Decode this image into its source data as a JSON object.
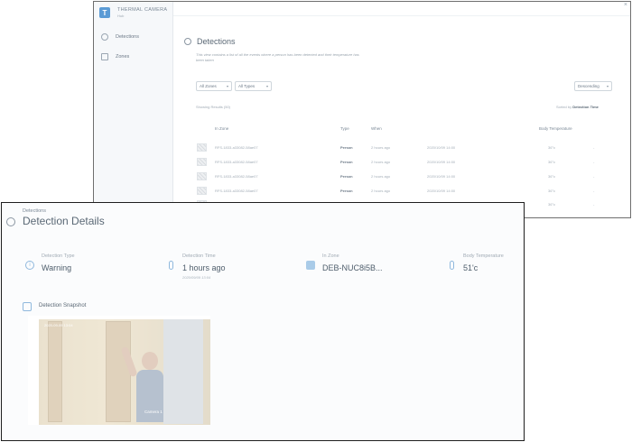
{
  "back": {
    "app": {
      "logo_letter": "T",
      "title": "THERMAL CAMERA",
      "subtitle": "Hub"
    },
    "nav": [
      {
        "label": "Detections",
        "icon": "detections-icon"
      },
      {
        "label": "Zones",
        "icon": "zones-icon"
      }
    ],
    "close_label": "×",
    "heading": "Detections",
    "description": "This view contains a list of all the events where a person has been detected and their temperature has been taken",
    "filters": {
      "zones": "All Zones",
      "types": "All Types",
      "order": "Descending"
    },
    "showing": "Showing Results (50)",
    "sorted_prefix": "Sorted by",
    "sorted_field": "Detection Time",
    "columns": [
      "In Zone",
      "Type",
      "When",
      "Body Temperature"
    ],
    "rows": [
      {
        "zone": "RFS-1833-a33082-58ae07",
        "type": "Person",
        "when": "2 hours ago",
        "date": "2020/10/09 14:00",
        "temp": "36°c",
        "dash": "-"
      },
      {
        "zone": "RFS-1833-a33082-58ae07",
        "type": "Person",
        "when": "2 hours ago",
        "date": "2020/10/09 14:00",
        "temp": "36°c",
        "dash": "-"
      },
      {
        "zone": "RFS-1833-a33082-58ae07",
        "type": "Person",
        "when": "2 hours ago",
        "date": "2020/10/09 14:00",
        "temp": "36°c",
        "dash": "-"
      },
      {
        "zone": "RFS-1833-a33082-58ae07",
        "type": "Person",
        "when": "2 hours ago",
        "date": "2020/10/09 14:00",
        "temp": "36°c",
        "dash": "-"
      },
      {
        "zone": "RFS-1833-a33082-58ae07",
        "type": "Person",
        "when": "2 hours ago",
        "date": "2020/10/09 14:00",
        "temp": "36°c",
        "dash": "-"
      },
      {
        "zone": "",
        "type": "",
        "when": "",
        "date": "",
        "temp": "36°c",
        "dash": ""
      }
    ]
  },
  "front": {
    "breadcrumb": "Detections",
    "title": "Detection Details",
    "fields": [
      {
        "label": "Detection Type",
        "value": "Warning",
        "sub": ""
      },
      {
        "label": "Detection Time",
        "value": "1 hours ago",
        "sub": "2020/09/09 13:04"
      },
      {
        "label": "In Zone",
        "value": "DEB-NUC8i5B...",
        "sub": ""
      },
      {
        "label": "Body Temperature",
        "value": "51'c",
        "sub": ""
      }
    ],
    "snapshot_label": "Detection Snapshot",
    "snapshot_stamp": "2020-09-09 13:04",
    "snapshot_camera": "Camera 1"
  }
}
